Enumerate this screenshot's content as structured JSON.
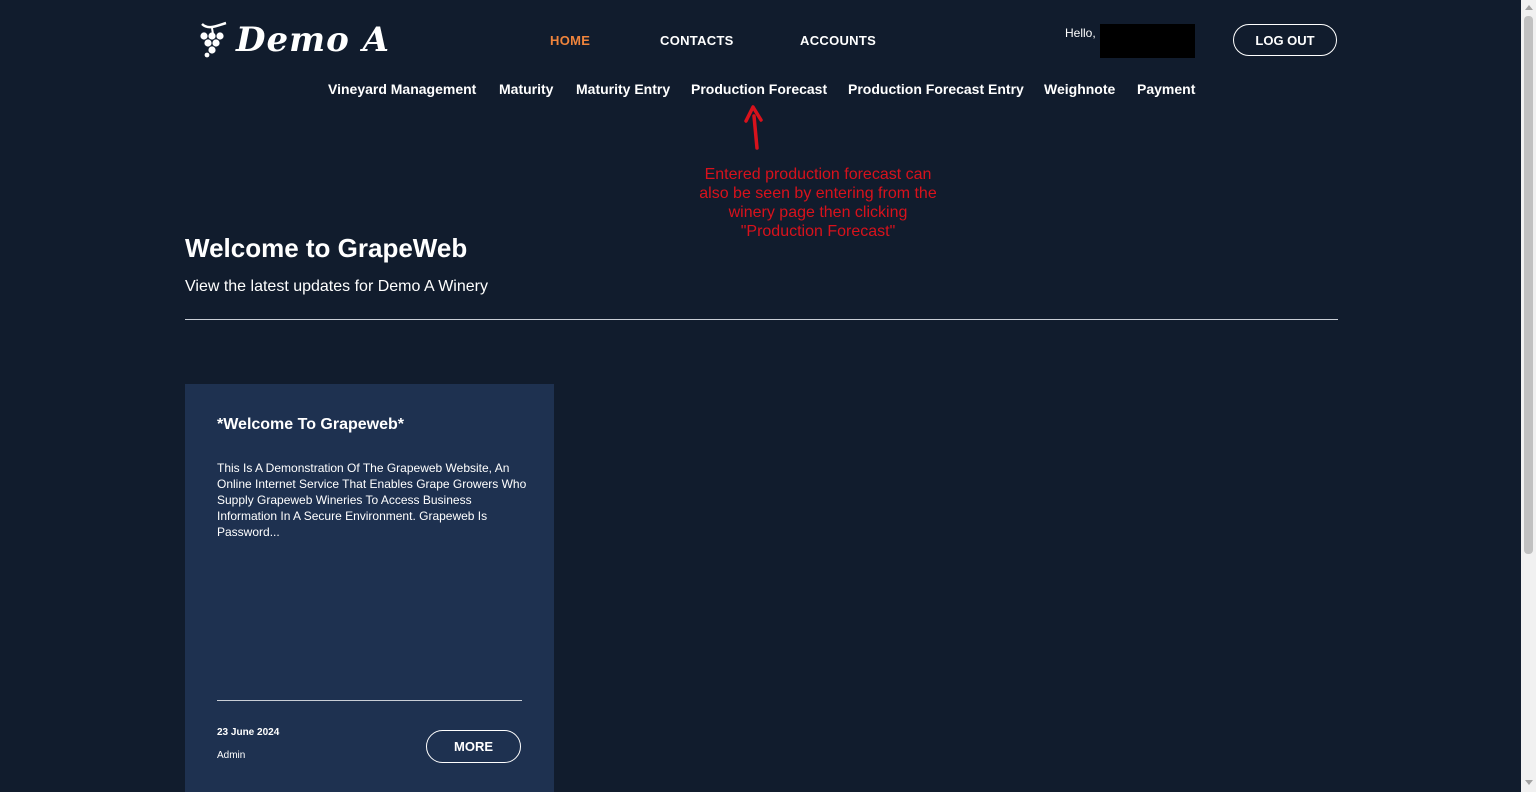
{
  "brand": {
    "name": "Demo A",
    "logo_icon": "grapes-icon"
  },
  "topnav": [
    {
      "label": "HOME",
      "active": true
    },
    {
      "label": "CONTACTS",
      "active": false
    },
    {
      "label": "ACCOUNTS",
      "active": false
    }
  ],
  "user": {
    "greeting": "Hello,",
    "logout_label": "LOG OUT"
  },
  "subnav": [
    {
      "label": "Vineyard Management"
    },
    {
      "label": "Maturity"
    },
    {
      "label": "Maturity Entry"
    },
    {
      "label": "Production Forecast"
    },
    {
      "label": "Production Forecast Entry"
    },
    {
      "label": "Weighnote"
    },
    {
      "label": "Payment"
    }
  ],
  "annotation": {
    "lines": [
      "Entered production forecast can",
      "also be seen by entering from the",
      "winery page then clicking",
      "\"Production Forecast\""
    ],
    "color": "#d8121c"
  },
  "hero": {
    "title": "Welcome to GrapeWeb",
    "subtitle": "View the latest updates for Demo A Winery"
  },
  "news_card": {
    "title": "*Welcome To Grapeweb*",
    "excerpt": "This Is A Demonstration Of The Grapeweb Website, An Online Internet Service That Enables Grape Growers Who Supply Grapeweb Wineries To Access Business Information In A Secure Environment. Grapeweb Is Password...",
    "date": "23 June 2024",
    "author": "Admin",
    "more_label": "MORE"
  },
  "colors": {
    "background": "#111c2d",
    "card": "#1e3150",
    "active_nav": "#f0843c",
    "text": "#ffffff"
  }
}
